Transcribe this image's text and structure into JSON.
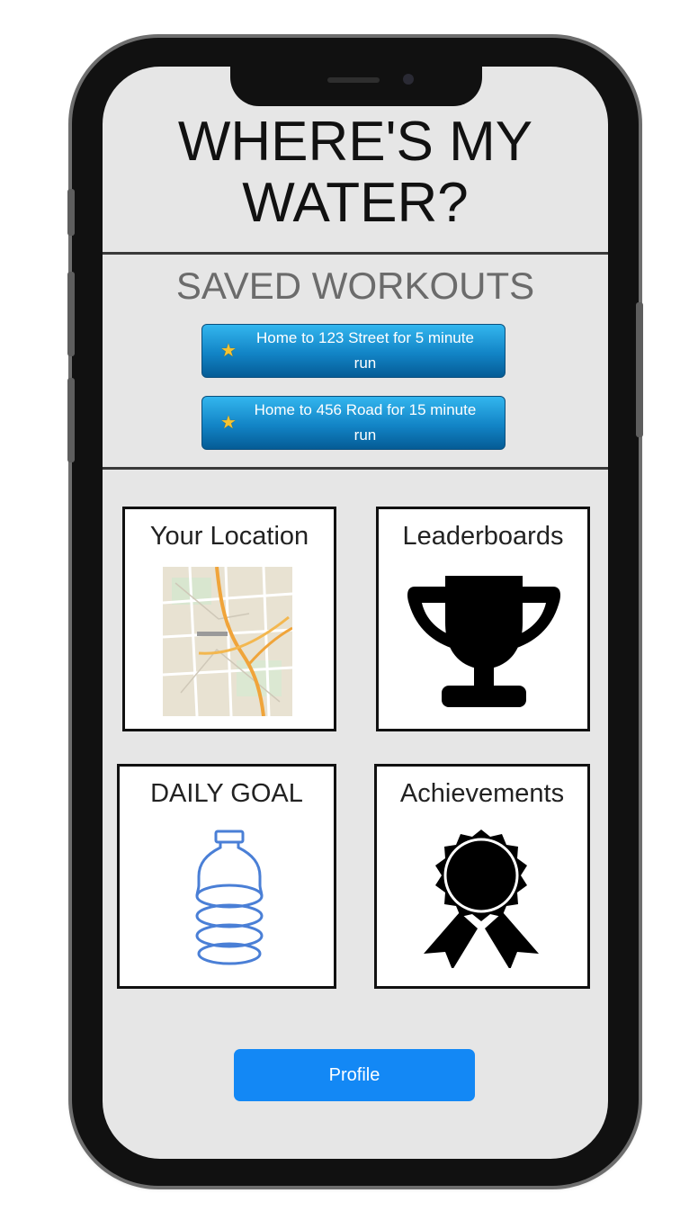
{
  "app": {
    "title": "WHERE'S MY\nWATER?"
  },
  "saved_workouts": {
    "heading": "SAVED WORKOUTS",
    "items": [
      {
        "label": "Home to 123 Street for 5 minute run",
        "icon": "star-icon"
      },
      {
        "label": "Home to 456 Road for 15 minute run",
        "icon": "star-icon"
      }
    ]
  },
  "tiles": [
    {
      "label": "Your Location",
      "icon": "map-icon"
    },
    {
      "label": "Leaderboards",
      "icon": "trophy-icon"
    },
    {
      "label": "DAILY GOAL",
      "icon": "water-bottle-icon"
    },
    {
      "label": "Achievements",
      "icon": "award-ribbon-icon"
    }
  ],
  "profile": {
    "label": "Profile"
  },
  "colors": {
    "screen_bg": "#e6e6e6",
    "workout_button": "#1284c6",
    "profile_button": "#1388f5",
    "bottle_stroke": "#4a7fd6",
    "star": "#f5c331"
  }
}
